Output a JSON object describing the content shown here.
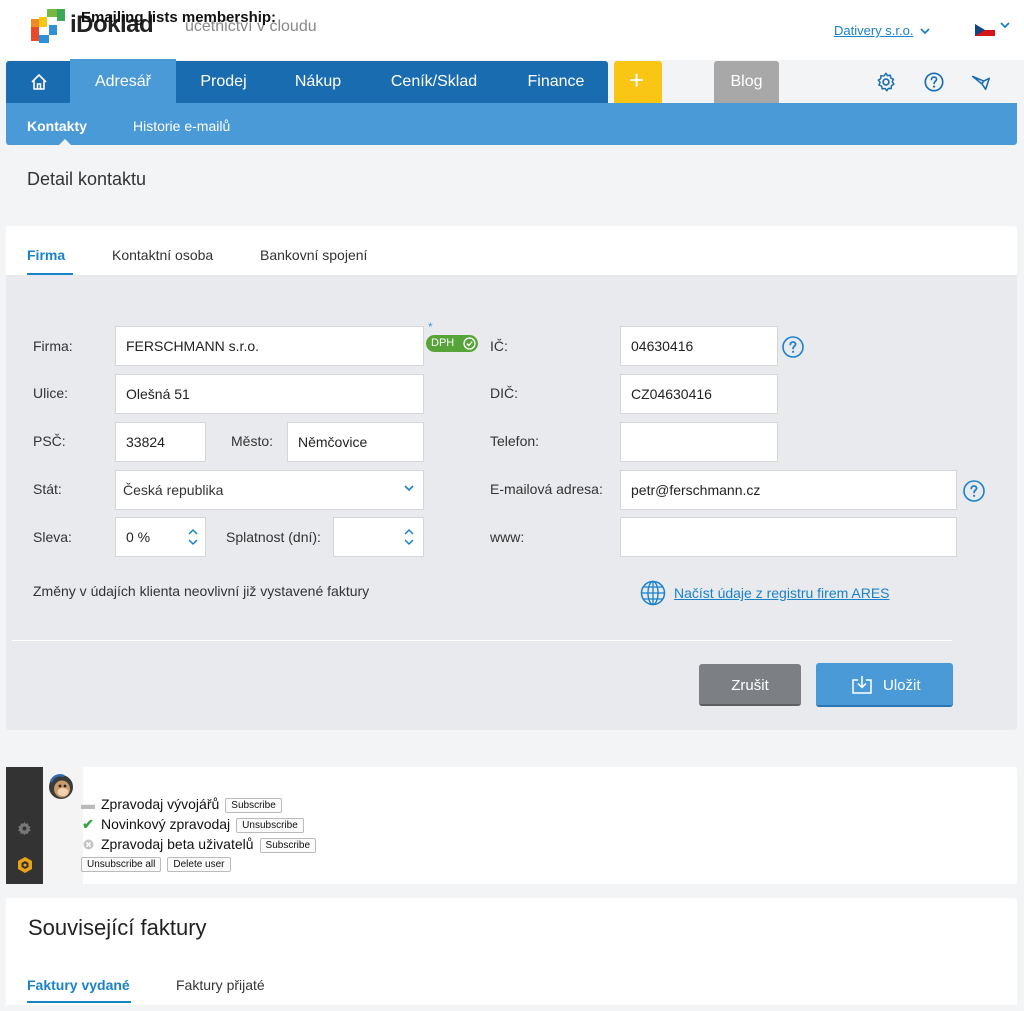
{
  "header": {
    "logo_text": "iDoklad",
    "tagline": "účetnictví v cloudu",
    "company": "Dativery s.r.o."
  },
  "nav": {
    "items": [
      {
        "label": "Adresář"
      },
      {
        "label": "Prodej"
      },
      {
        "label": "Nákup"
      },
      {
        "label": "Ceník/Sklad"
      },
      {
        "label": "Finance"
      }
    ],
    "plus": "+",
    "blog": "Blog"
  },
  "subnav": {
    "items": [
      {
        "label": "Kontakty"
      },
      {
        "label": "Historie e-mailů"
      }
    ]
  },
  "page_title": "Detail kontaktu",
  "tabs": [
    {
      "label": "Firma"
    },
    {
      "label": "Kontaktní osoba"
    },
    {
      "label": "Bankovní spojení"
    }
  ],
  "form": {
    "firma_label": "Firma:",
    "firma_value": "FERSCHMANN s.r.o.",
    "dph_badge": "DPH",
    "dph_star": "*",
    "ulice_label": "Ulice:",
    "ulice_value": "Olešná 51",
    "psc_label": "PSČ:",
    "psc_value": "33824",
    "mesto_label": "Město:",
    "mesto_value": "Němčovice",
    "stat_label": "Stát:",
    "stat_value": "Česká republika",
    "sleva_label": "Sleva:",
    "sleva_value": "0 %",
    "splatnost_label": "Splatnost (dní):",
    "splatnost_value": "",
    "ic_label": "IČ:",
    "ic_value": "04630416",
    "dic_label": "DIČ:",
    "dic_value": "CZ04630416",
    "telefon_label": "Telefon:",
    "telefon_value": "",
    "email_label": "E-mailová adresa:",
    "email_value": "petr@ferschmann.cz",
    "www_label": "www:",
    "www_value": "",
    "note": "Změny v údajích klienta neovlivní již vystavené faktury",
    "ares_link": "Načíst údaje z registru firem ARES",
    "cancel": "Zrušit",
    "save": "Uložit"
  },
  "mailchimp": {
    "title": "Emailing lists membership:",
    "lists": [
      {
        "name": "Zpravodaj vývojářů",
        "status": "none",
        "action": "Subscribe"
      },
      {
        "name": "Novinkový zpravodaj",
        "status": "subscribed",
        "action": "Unsubscribe"
      },
      {
        "name": "Zpravodaj beta uživatelů",
        "status": "unsubscribed",
        "action": "Subscribe"
      }
    ],
    "unsubscribe_all": "Unsubscribe all",
    "delete_user": "Delete user"
  },
  "related": {
    "title": "Související faktury",
    "tabs": [
      {
        "label": "Faktury vydané"
      },
      {
        "label": "Faktury přijaté"
      }
    ]
  },
  "colors": {
    "primary": "#1a6cb0",
    "accent": "#4a9ad8",
    "plus": "#f9c615",
    "link": "#1a82c8",
    "dph": "#57a53a"
  }
}
